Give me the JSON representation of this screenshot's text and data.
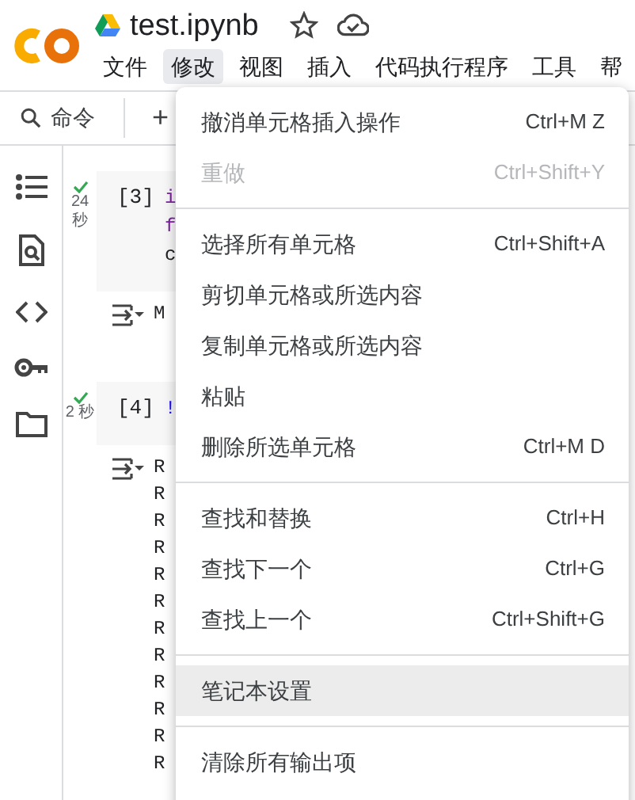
{
  "app": {
    "title": "test.ipynb",
    "starred": false
  },
  "menubar": [
    {
      "label": "文件",
      "selected": false
    },
    {
      "label": "修改",
      "selected": true
    },
    {
      "label": "视图",
      "selected": false
    },
    {
      "label": "插入",
      "selected": false
    },
    {
      "label": "代码执行程序",
      "selected": false
    },
    {
      "label": "工具",
      "selected": false
    },
    {
      "label": "帮",
      "selected": false
    }
  ],
  "toolbar": {
    "search": "命令",
    "add": "+"
  },
  "cells": [
    {
      "number": "[3]",
      "time": "24 秒",
      "code": [
        {
          "text": "i",
          "kind": "keyword"
        },
        {
          "text": "f",
          "kind": "keyword"
        },
        {
          "text": "c",
          "kind": "plain"
        }
      ],
      "output": [
        "M"
      ]
    },
    {
      "number": "[4]",
      "time": "2 秒",
      "code": [
        {
          "text": "!",
          "kind": "shell"
        }
      ],
      "output": [
        "R",
        "R",
        "R",
        "R",
        "R",
        "R",
        "R",
        "R",
        "R",
        "R",
        "R",
        "R"
      ]
    }
  ],
  "menu": {
    "groups": [
      [
        {
          "label": "撤消单元格插入操作",
          "shortcut": "Ctrl+M Z",
          "disabled": false,
          "selected": false
        },
        {
          "label": "重做",
          "shortcut": "Ctrl+Shift+Y",
          "disabled": true,
          "selected": false
        }
      ],
      [
        {
          "label": "选择所有单元格",
          "shortcut": "Ctrl+Shift+A",
          "disabled": false,
          "selected": false
        },
        {
          "label": "剪切单元格或所选内容",
          "disabled": false,
          "selected": false
        },
        {
          "label": "复制单元格或所选内容",
          "disabled": false,
          "selected": false
        },
        {
          "label": "粘贴",
          "disabled": false,
          "selected": false
        },
        {
          "label": "删除所选单元格",
          "shortcut": "Ctrl+M D",
          "disabled": false,
          "selected": false
        }
      ],
      [
        {
          "label": "查找和替换",
          "shortcut": "Ctrl+H",
          "disabled": false,
          "selected": false
        },
        {
          "label": "查找下一个",
          "shortcut": "Ctrl+G",
          "disabled": false,
          "selected": false
        },
        {
          "label": "查找上一个",
          "shortcut": "Ctrl+Shift+G",
          "disabled": false,
          "selected": false
        }
      ],
      [
        {
          "label": "笔记本设置",
          "disabled": false,
          "selected": true
        }
      ],
      [
        {
          "label": "清除所有输出项",
          "disabled": false,
          "selected": false
        }
      ]
    ]
  }
}
